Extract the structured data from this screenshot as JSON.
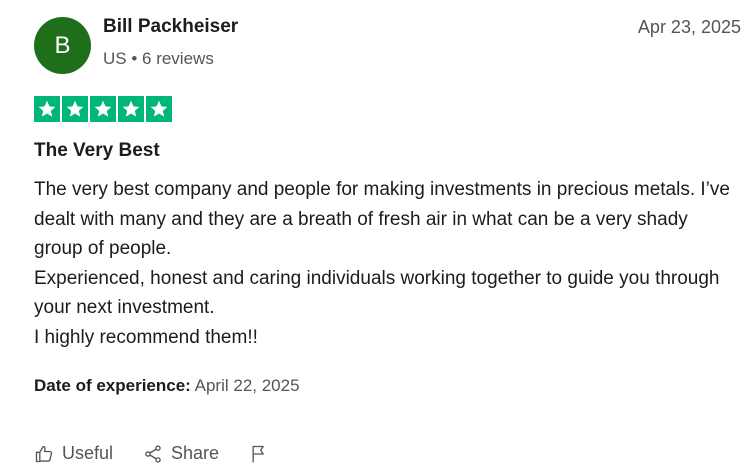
{
  "review": {
    "avatar_initial": "B",
    "reviewer_name": "Bill Packheiser",
    "reviewer_meta": "US • 6 reviews",
    "date": "Apr 23, 2025",
    "rating": 5,
    "title": "The Very Best",
    "body_lines": [
      "The very best company and people for making investments in precious metals. I’ve dealt with many and they are a breath of fresh air in what can be a very shady group of people.",
      "Experienced, honest and caring individuals working together to guide you through your next investment.",
      "I highly recommend them!!"
    ],
    "experience_label": "Date of experience:",
    "experience_date": "April 22, 2025"
  },
  "actions": {
    "useful_label": "Useful",
    "share_label": "Share"
  },
  "colors": {
    "avatar_bg": "#1f6e1a",
    "star_green": "#00b67a"
  }
}
